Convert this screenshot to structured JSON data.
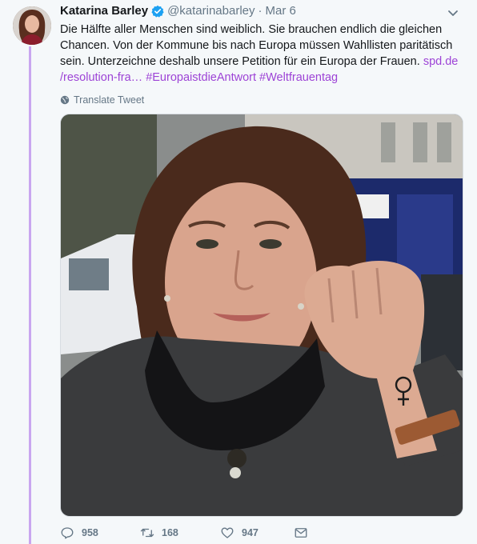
{
  "tweet": {
    "author_name": "Katarina Barley",
    "handle": "@katarinabarley",
    "separator": "·",
    "date": "Mar 6",
    "text_part1": "Die Hälfte aller Menschen sind weiblich. Sie brauchen endlich die gleichen Chancen. Von der Kommune bis nach Europa müssen Wahllisten paritätisch sein. Unterzeichne deshalb unsere Petition für ein Europa der Frauen. ",
    "link_text": "spd.de\n/resolution-fra…",
    "link_line1": "spd.de",
    "link_line2": "/resolution-fra…",
    "hashtag1": "#EuropaistdieAntwort",
    "hashtag2": "#Weltfrauentag",
    "translate_label": "Translate Tweet"
  },
  "actions": {
    "reply_count": "958",
    "retweet_count": "168",
    "like_count": "947"
  },
  "colors": {
    "link": "#9d43d6",
    "thread_line": "#c9a6ef",
    "verified": "#1da1f2",
    "muted": "#657786"
  }
}
